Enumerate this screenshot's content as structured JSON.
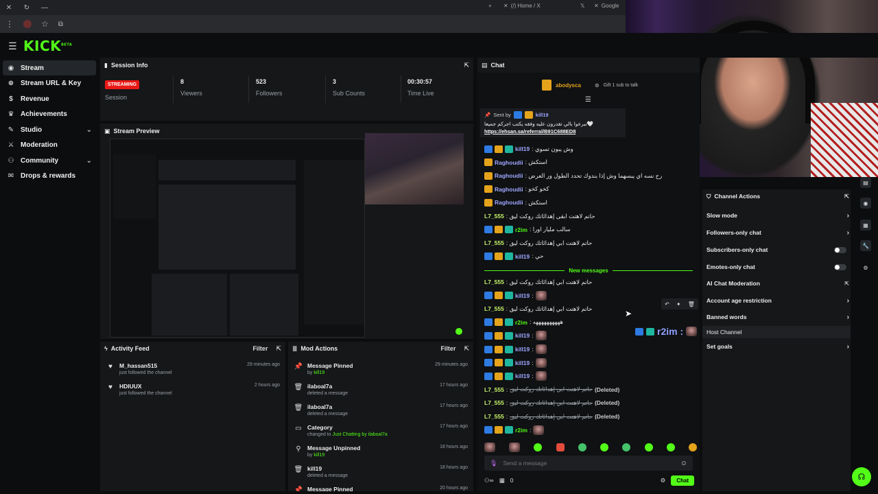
{
  "browser": {
    "tabs": [
      "(/) Home / X",
      "Google"
    ],
    "new_tab": "+"
  },
  "brand": {
    "logo": "KICK",
    "logo_sup": "BETA"
  },
  "sidebar": {
    "items": [
      {
        "label": "Stream",
        "icon": "broadcast-icon"
      },
      {
        "label": "Stream URL & Key",
        "icon": "globe-icon"
      },
      {
        "label": "Revenue",
        "icon": "dollar-icon"
      },
      {
        "label": "Achievements",
        "icon": "trophy-icon"
      },
      {
        "label": "Studio",
        "icon": "brush-icon"
      },
      {
        "label": "Moderation",
        "icon": "sword-icon"
      },
      {
        "label": "Community",
        "icon": "people-icon"
      },
      {
        "label": "Drops & rewards",
        "icon": "gift-icon"
      }
    ]
  },
  "session": {
    "title": "Session Info",
    "badge": "STREAMING",
    "badge_label": "Session",
    "stats": [
      {
        "value": "8",
        "label": "Viewers"
      },
      {
        "value": "523",
        "label": "Followers"
      },
      {
        "value": "3",
        "label": "Sub Counts"
      },
      {
        "value": "00:30:57",
        "label": "Time Live"
      }
    ]
  },
  "preview": {
    "title": "Stream Preview"
  },
  "activity": {
    "title": "Activity Feed",
    "filter": "Filter",
    "items": [
      {
        "name": "M_hassan515",
        "desc": "just followed the channel",
        "time": "29 minutes ago"
      },
      {
        "name": "HDIUUX",
        "desc": "just followed the channel",
        "time": "2 hours ago"
      }
    ]
  },
  "mod": {
    "title": "Mod Actions",
    "filter": "Filter",
    "items": [
      {
        "title": "Message Pinned",
        "pre": "by",
        "who": "kill19",
        "post": "",
        "time": "29 minutes ago",
        "icon": "pin-icon"
      },
      {
        "title": "ilaboal7a",
        "pre": "deleted a message",
        "who": "",
        "post": "",
        "time": "17 hours ago",
        "icon": "trash-icon"
      },
      {
        "title": "ilaboal7a",
        "pre": "deleted a message",
        "who": "",
        "post": "",
        "time": "17 hours ago",
        "icon": "trash-icon"
      },
      {
        "title": "Category",
        "pre": "changed to",
        "who": "Just Chatting",
        "post": "by ilaboal7a",
        "time": "17 hours ago",
        "icon": "category-icon"
      },
      {
        "title": "Message Unpinned",
        "pre": "by",
        "who": "kill19",
        "post": "",
        "time": "18 hours ago",
        "icon": "unpin-icon"
      },
      {
        "title": "kill19",
        "pre": "deleted a message",
        "who": "",
        "post": "",
        "time": "18 hours ago",
        "icon": "trash-icon"
      },
      {
        "title": "Message Pinned",
        "pre": "",
        "who": "",
        "post": "",
        "time": "20 hours ago",
        "icon": "pin-icon"
      }
    ]
  },
  "chat": {
    "title": "Chat",
    "gifter": "abodysca",
    "gift_text": "Gift 1 sub to talk",
    "pinned": {
      "sent_by": "Sent by",
      "user": "kill19",
      "text": "تبرعوا بالي تقدرون عليه وفقه يكتب اجركم جميعا🤍",
      "link": "https://ehsan.sa/referral/B91C688ED8"
    },
    "lines": [
      {
        "badges": [
          "blue",
          "gold",
          "teal"
        ],
        "user": "kill19",
        "cls": "p",
        "text": ": وش يبون تسوي"
      },
      {
        "badges": [
          "gold"
        ],
        "user": "Raghoudii",
        "cls": "p",
        "text": ": استكش"
      },
      {
        "badges": [
          "gold"
        ],
        "user": "Raghoudii",
        "cls": "p",
        "text": ": رح نسه اي يبسهما وش إذا بندوك تحدد الطول ور العرض"
      },
      {
        "badges": [
          "gold"
        ],
        "user": "Raghoudii",
        "cls": "p",
        "text": ": كخو كخو"
      },
      {
        "badges": [
          "gold"
        ],
        "user": "Raghoudii",
        "cls": "p",
        "text": ": استكش"
      },
      {
        "badges": [],
        "user": "L7_555",
        "cls": "y",
        "text": ": حاتم لاهتت ابقى إهدائاتك روكت ليق"
      },
      {
        "badges": [
          "blue",
          "gold",
          "teal"
        ],
        "user": "r2im",
        "cls": "g",
        "text": ": سالب مليار اورا"
      },
      {
        "badges": [],
        "user": "L7_555",
        "cls": "y",
        "text": ": حاتم لاهتت ابي إهدائاتك روكت ليق"
      },
      {
        "badges": [
          "blue",
          "gold",
          "teal"
        ],
        "user": "kill19",
        "cls": "p",
        "text": ": حي"
      }
    ],
    "new_messages": "New messages",
    "lines2": [
      {
        "badges": [],
        "user": "L7_555",
        "cls": "y",
        "text": ": حاتم لاهتت ابي إهدائاتك روكت ليق",
        "emote": false,
        "del": false
      },
      {
        "badges": [
          "blue",
          "gold",
          "teal"
        ],
        "user": "kill19",
        "cls": "p",
        "text": ":",
        "emote": true,
        "del": false
      },
      {
        "badges": [],
        "user": "L7_555",
        "cls": "y",
        "text": ": حاتم لاهتت ابي إهدائاتك روكت ليق",
        "emote": false,
        "del": false
      },
      {
        "badges": [
          "blue",
          "gold",
          "teal"
        ],
        "user": "r2im",
        "cls": "g",
        "text": ": ههههههههههه",
        "emote": false,
        "del": false
      },
      {
        "badges": [
          "blue",
          "gold",
          "teal"
        ],
        "user": "kill19",
        "cls": "p",
        "text": ":",
        "emote": true,
        "del": false
      },
      {
        "badges": [
          "blue",
          "gold",
          "teal"
        ],
        "user": "kill19",
        "cls": "p",
        "text": ":",
        "emote": true,
        "del": false
      },
      {
        "badges": [
          "blue",
          "gold",
          "teal"
        ],
        "user": "kill19",
        "cls": "p",
        "text": ":",
        "emote": true,
        "del": false
      },
      {
        "badges": [
          "blue",
          "gold",
          "teal"
        ],
        "user": "kill19",
        "cls": "p",
        "text": ":",
        "emote": true,
        "del": false
      },
      {
        "badges": [],
        "user": "L7_555",
        "cls": "y",
        "text": "حاتم لاهتت ابي إهدائاتك روكت ليق",
        "emote": false,
        "del": true
      },
      {
        "badges": [],
        "user": "L7_555",
        "cls": "y",
        "text": "حاتم لاهتت ابي إهدائاتك روكت ليق",
        "emote": false,
        "del": true
      },
      {
        "badges": [],
        "user": "L7_555",
        "cls": "y",
        "text": "حاتم لاهتت ابي إهدائاتك روكت ليق",
        "emote": false,
        "del": true
      },
      {
        "badges": [
          "blue",
          "gold",
          "teal"
        ],
        "user": "r2im",
        "cls": "g",
        "text": ":",
        "emote": true,
        "del": false
      }
    ],
    "deleted_tag": "(Deleted)",
    "overlay_user": "r2im :",
    "input_placeholder": "Send a message",
    "viewer_count": "0",
    "send_label": "Chat"
  },
  "channel_actions": {
    "title": "Channel Actions",
    "items": [
      {
        "label": "Slow mode",
        "kind": "chevron"
      },
      {
        "label": "Followers-only chat",
        "kind": "chevron"
      },
      {
        "label": "Subscribers-only chat",
        "kind": "toggle"
      },
      {
        "label": "Emotes-only chat",
        "kind": "toggle"
      },
      {
        "label": "AI Chat Moderation",
        "kind": "external"
      },
      {
        "label": "Account age restriction",
        "kind": "chevron"
      },
      {
        "label": "Banned words",
        "kind": "chevron"
      },
      {
        "label": "Host Channel",
        "kind": "none"
      },
      {
        "label": "Set goals",
        "kind": "chevron"
      }
    ]
  },
  "colors": {
    "accent": "#53fc18",
    "live": "#e91916",
    "panel": "#151719",
    "bg": "#0b0d0f"
  }
}
